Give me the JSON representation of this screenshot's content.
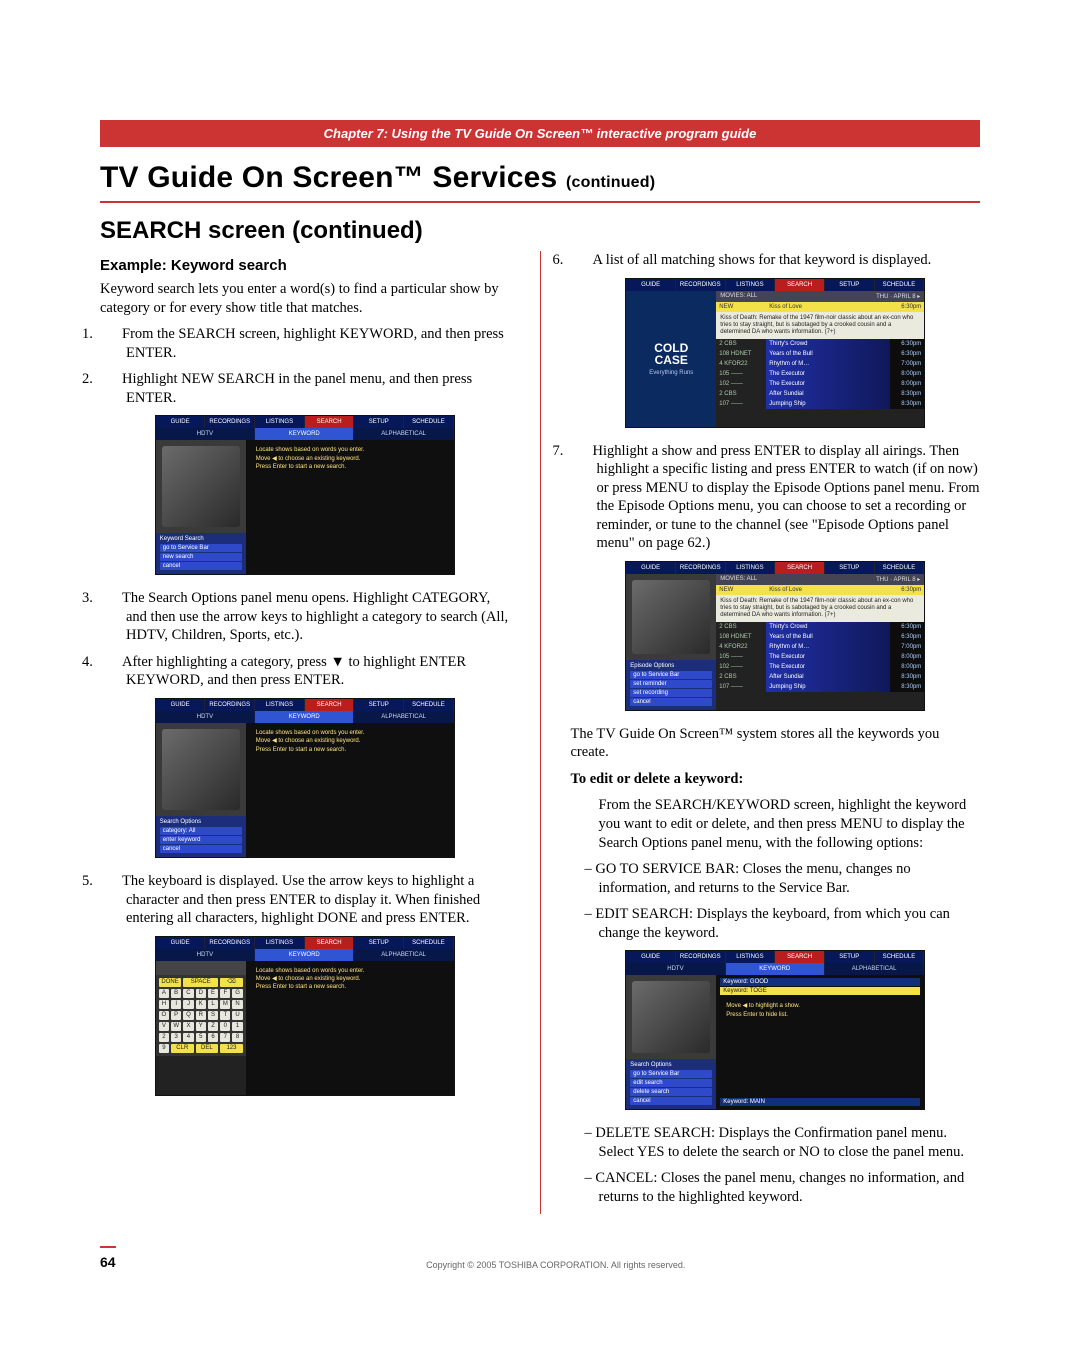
{
  "chapter_bar": "Chapter 7: Using the TV Guide On Screen™ interactive program guide",
  "h1_main": "TV Guide On Screen™ Services ",
  "h1_cont": "(continued)",
  "h2_search": "SEARCH screen (continued)",
  "h3_example": "Example: Keyword search",
  "intro": "Keyword search lets you enter a word(s) to find a particular show by category or for every show title that matches.",
  "steps_left": {
    "s1": "From the SEARCH screen, highlight KEYWORD, and then press ENTER.",
    "s2": "Highlight NEW SEARCH in the panel menu, and then press ENTER.",
    "s3": "The Search Options panel menu opens. Highlight CATEGORY, and then use the arrow keys to highlight a category to search (All, HDTV, Children, Sports, etc.).",
    "s4_a": "After highlighting a category, press ",
    "s4_b": " to highlight ENTER KEYWORD, and then press ENTER.",
    "s5": "The keyboard is displayed. Use the arrow keys to highlight a character and then press ENTER to display it. When finished entering all characters, highlight DONE and press ENTER."
  },
  "steps_right": {
    "s6": "A list of all matching shows for that keyword is displayed.",
    "s7": "Highlight a show and press ENTER to display all airings. Then highlight a specific listing and press ENTER to watch (if on now) or press MENU to display the Episode Options panel menu. From the Episode Options menu, you can choose to set a recording or reminder, or tune to the channel (see \"Episode Options panel menu\" on page 62.)"
  },
  "stores_line": "The TV Guide On Screen™ system stores all the keywords you create.",
  "edit_delete_heading": "To edit or delete a keyword:",
  "edit_delete_body": "From the SEARCH/KEYWORD screen, highlight the keyword you want to edit or delete, and then press MENU to display the Search Options panel menu, with the following options:",
  "options": {
    "o1": "GO TO SERVICE BAR: Closes the menu, changes no information, and returns to the Service Bar.",
    "o2": "EDIT SEARCH: Displays the keyboard, from which you can change the keyword.",
    "o3": "DELETE SEARCH: Displays the Confirmation panel menu. Select YES to delete the search or NO to close the panel menu.",
    "o4": "CANCEL: Closes the panel menu, changes no information, and returns to the highlighted keyword."
  },
  "footer_copy": "Copyright © 2005 TOSHIBA CORPORATION. All rights reserved.",
  "page_number": "64",
  "ss_tabs": [
    "GUIDE",
    "RECORDINGS",
    "LISTINGS",
    "SEARCH",
    "SETUP",
    "SCHEDULE"
  ],
  "ss_subs": [
    "HDTV",
    "KEYWORD",
    "ALPHABETICAL"
  ],
  "ss_hint_lines": {
    "l1": "Locate shows based on words you enter.",
    "l2": "Move ◀ to choose an existing keyword.",
    "l3": "Press Enter to start a new search."
  },
  "ss_panelA": {
    "title": "Keyword Search",
    "f1": "go to Service Bar",
    "f2": "new search",
    "f3": "cancel"
  },
  "ss_panelB": {
    "title": "Search Options",
    "f1": "category:   All",
    "f2": "enter keyword",
    "f3": "cancel"
  },
  "cold": {
    "line1": "COLD",
    "line2": "CASE",
    "sub": "Everything Runs"
  },
  "movies_header": "MOVIES: ALL",
  "movies_date": "THU · APRIL 8 ▸",
  "movie_title": "Kiss of Love",
  "movie_time": "6:30pm",
  "movie_desc": "Kiss of Death: Remake of the 1947 film-noir classic about an ex-con who tries to stay straight, but is sabotaged by a crooked cousin and a determined DA who wants information. (7+)",
  "results": [
    {
      "ch": "2 CBS",
      "ttl": "Thirty's Crowd",
      "tm": "6:30pm"
    },
    {
      "ch": "108 HDNET",
      "ttl": "Years of the Bull",
      "tm": "6:30pm"
    },
    {
      "ch": "4 KFOR22",
      "ttl": "Rhythm of M…",
      "tm": "7:00pm"
    },
    {
      "ch": "105 ——",
      "ttl": "The Executor",
      "tm": "8:00pm"
    },
    {
      "ch": "102 ——",
      "ttl": "The Executor",
      "tm": "8:00pm"
    },
    {
      "ch": "2 CBS",
      "ttl": "After Sundial",
      "tm": "8:30pm"
    },
    {
      "ch": "107 ——",
      "ttl": "Jumping Ship",
      "tm": "8:30pm"
    }
  ],
  "ss_panelC": {
    "title": "Episode Options",
    "f1": "go to Service Bar",
    "f2": "set reminder",
    "f3": "set recording",
    "f4": "cancel"
  },
  "ss_kwheader": "Keyword: TOGE",
  "ss_kwhint1": "Move ◀ to highlight a show.",
  "ss_kwhint2": "Press Enter to hide list.",
  "ss_kw_saved1": "Keyword: GOOD",
  "ss_kw_saved2": "Keyword: MAIN",
  "ss_panelD": {
    "title": "Search Options",
    "f1": "go to Service Bar",
    "f2": "edit search",
    "f3": "delete search",
    "f4": "cancel"
  }
}
